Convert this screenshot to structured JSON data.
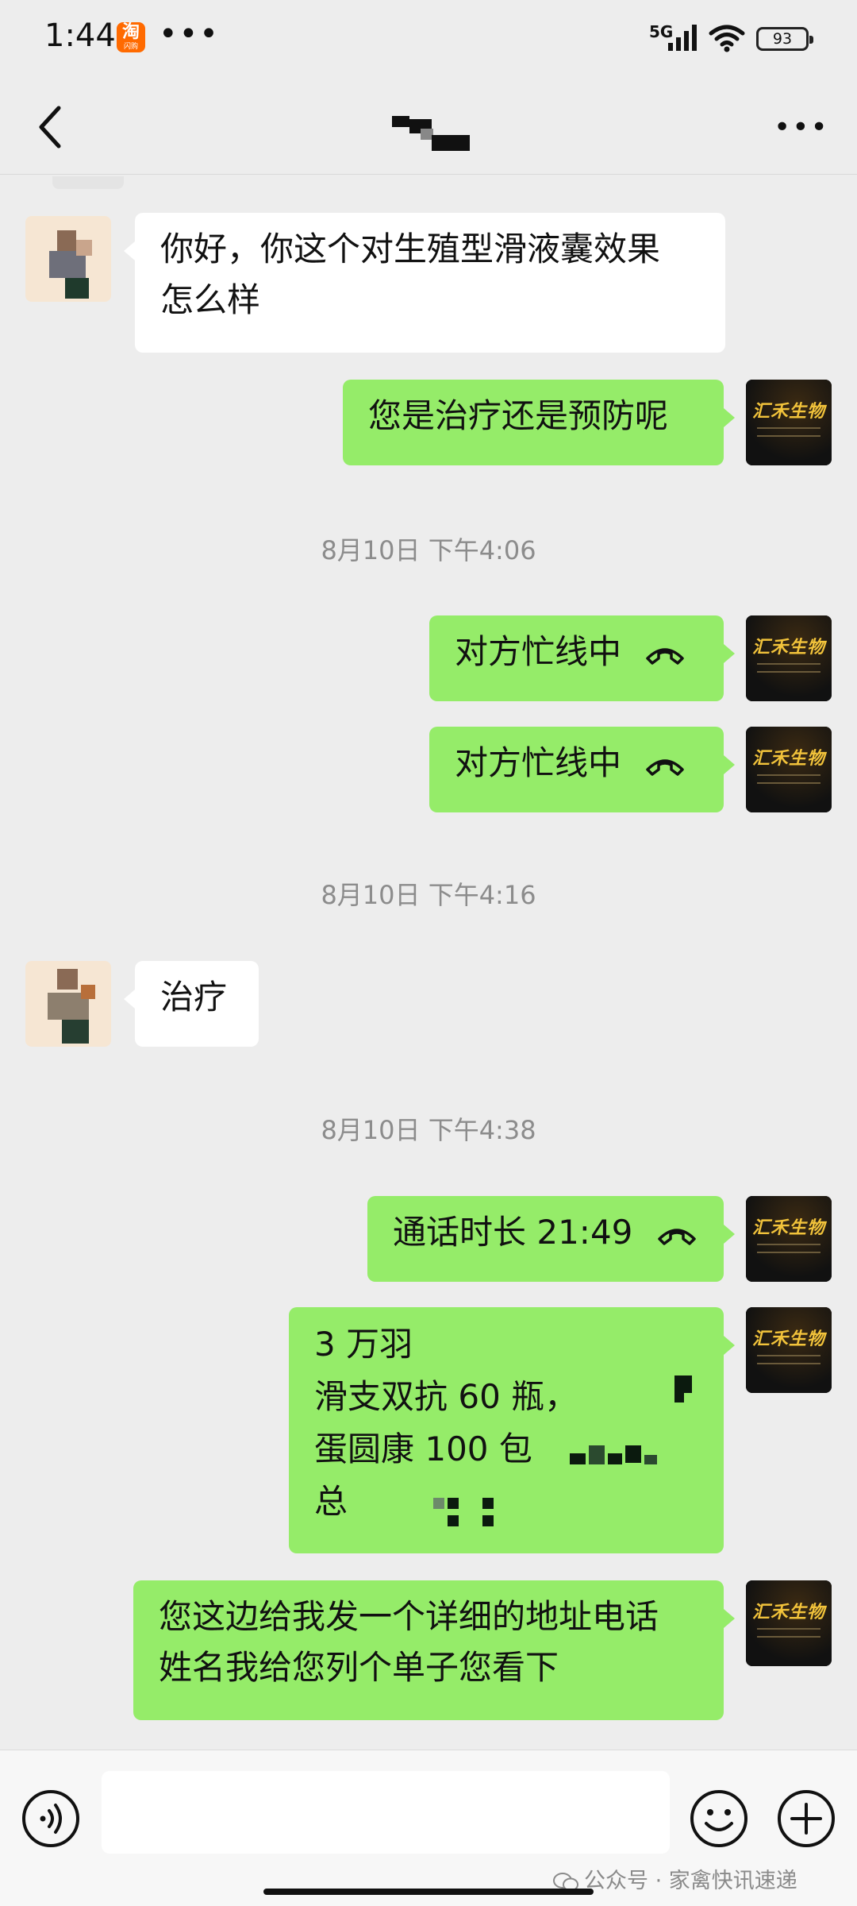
{
  "status_bar": {
    "time": "1:44",
    "app_badge": "淘",
    "app_badge_sub": "闪购",
    "dots": "•••",
    "network": "5G",
    "battery": "93"
  },
  "header": {
    "back_icon": "chevron-left-icon",
    "more": "•••"
  },
  "messages": [
    {
      "side": "left",
      "text_lines": [
        "你好，你这个对生殖型滑液囊效果",
        "怎么样"
      ]
    },
    {
      "side": "right",
      "text_lines": [
        "您是治疗还是预防呢"
      ]
    },
    {
      "timestamp": "8月10日 下午4:06"
    },
    {
      "side": "right",
      "call": true,
      "text": "对方忙线中"
    },
    {
      "side": "right",
      "call": true,
      "text": "对方忙线中"
    },
    {
      "timestamp": "8月10日 下午4:16"
    },
    {
      "side": "left",
      "text_lines": [
        "治疗"
      ]
    },
    {
      "timestamp": "8月10日 下午4:38"
    },
    {
      "side": "right",
      "call": true,
      "text": "通话时长 21:49"
    },
    {
      "side": "right",
      "text_lines": [
        "3 万羽",
        "滑支双抗 60 瓶，",
        "蛋圆康 100 包",
        "总"
      ]
    },
    {
      "side": "right",
      "text_lines": [
        "您这边给我发一个详细的地址电话",
        "姓名我给您列个单子您看下"
      ]
    }
  ],
  "brand_avatar_text": "汇禾生物",
  "input_bar": {
    "voice_icon": "voice-icon",
    "emoji_icon": "emoji-icon",
    "plus_icon": "plus-icon"
  },
  "watermark": "公众号 · 家禽快讯速递",
  "colors": {
    "background": "#ededed",
    "outgoing_bubble": "#95ec69",
    "incoming_bubble": "#ffffff",
    "timestamp": "#8c8c8c"
  }
}
